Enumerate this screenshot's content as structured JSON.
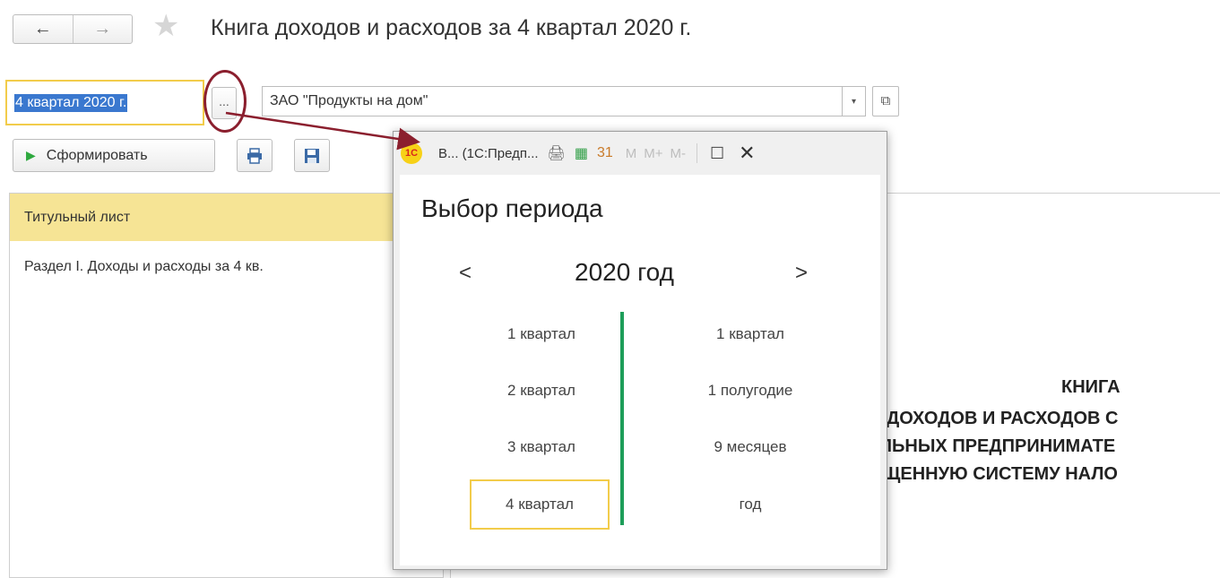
{
  "nav": {
    "back_icon": "←",
    "forward_icon": "→",
    "star_icon": "★"
  },
  "page": {
    "title": "Книга доходов и расходов за 4 квартал 2020 г."
  },
  "filters": {
    "period_value": "4 квартал 2020 г.",
    "ellipsis_label": "...",
    "organization_value": "ЗАО \"Продукты на дом\"",
    "dropdown_icon": "▾",
    "open_icon": "⧉"
  },
  "toolbar": {
    "generate_icon": "▶",
    "generate_label": "Сформировать",
    "print_icon": "🖶",
    "save_icon": "🖫"
  },
  "sections": {
    "items": [
      "Титульный лист",
      "Раздел I. Доходы и расходы за 4 кв."
    ]
  },
  "report": {
    "lines": [
      "КНИГА",
      "ДОХОДОВ И РАСХОДОВ С",
      "ЛЬНЫХ ПРЕДПРИНИМАТЕ",
      "ЩЕННУЮ СИСТЕМУ НАЛО"
    ]
  },
  "dialog": {
    "app_logo": "1С",
    "window_title": "В... (1С:Предп...",
    "titlebar_icons": [
      "🖨",
      "▦",
      "31"
    ],
    "memory_buttons": [
      "M",
      "M+",
      "M-"
    ],
    "maximize_icon": "☐",
    "close_icon": "✕",
    "heading": "Выбор периода",
    "prev_year_icon": "<",
    "next_year_icon": ">",
    "year_label": "2020 год",
    "quarters": [
      "1 квартал",
      "2 квартал",
      "3 квартал",
      "4 квартал"
    ],
    "cumulative": [
      "1 квартал",
      "1 полугодие",
      "9 месяцев",
      "год"
    ],
    "selected_quarter": "4 квартал"
  },
  "colors": {
    "accent_yellow": "#f2cc4b",
    "selection_blue": "#3a78cf",
    "divider_green": "#1e9e5a",
    "marker_red": "#8b1f2e"
  }
}
